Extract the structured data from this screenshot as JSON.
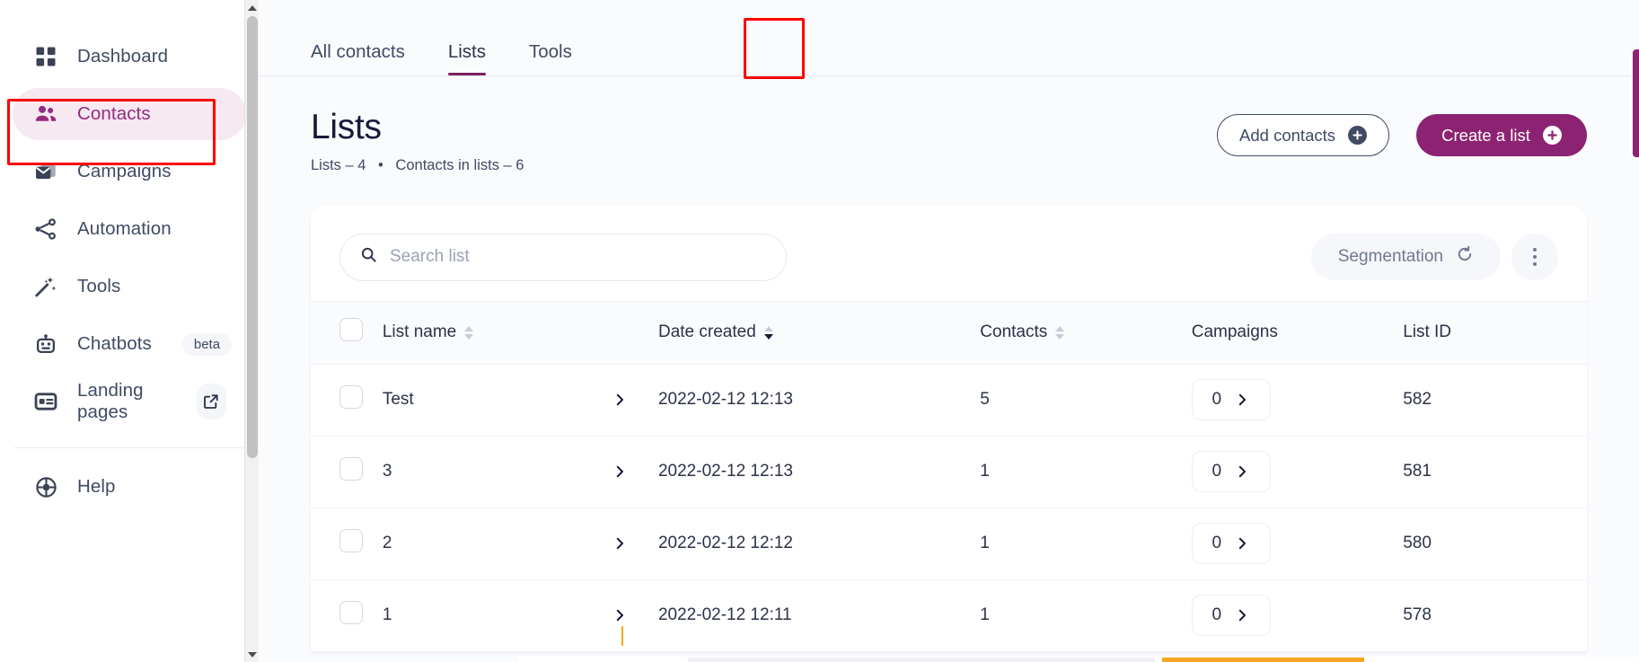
{
  "sidebar": {
    "items": [
      {
        "label": "Dashboard",
        "icon": "grid-icon",
        "active": false,
        "badge": null,
        "external": false
      },
      {
        "label": "Contacts",
        "icon": "contacts-icon",
        "active": true,
        "badge": null,
        "external": false
      },
      {
        "label": "Campaigns",
        "icon": "envelope-icon",
        "active": false,
        "badge": null,
        "external": false
      },
      {
        "label": "Automation",
        "icon": "automation-icon",
        "active": false,
        "badge": null,
        "external": false
      },
      {
        "label": "Tools",
        "icon": "magic-wand-icon",
        "active": false,
        "badge": null,
        "external": false
      },
      {
        "label": "Chatbots",
        "icon": "robot-icon",
        "active": false,
        "badge": "beta",
        "external": false
      },
      {
        "label": "Landing pages",
        "icon": "landing-page-icon",
        "active": false,
        "badge": null,
        "external": true
      }
    ],
    "help": {
      "label": "Help",
      "icon": "lifebuoy-icon"
    }
  },
  "tabs": [
    {
      "label": "All contacts",
      "active": false
    },
    {
      "label": "Lists",
      "active": true
    },
    {
      "label": "Tools",
      "active": false
    }
  ],
  "page": {
    "title": "Lists",
    "subtitle_lists": "Lists – 4",
    "subtitle_separator": "•",
    "subtitle_contacts": "Contacts in lists – 6"
  },
  "actions": {
    "add_contacts": "Add contacts",
    "create_list": "Create a list"
  },
  "toolbar": {
    "search_placeholder": "Search list",
    "search_value": "",
    "segmentation": "Segmentation",
    "more_menu": "more-options"
  },
  "table": {
    "columns": [
      {
        "key": "name",
        "label": "List name",
        "sortable": true,
        "sort": "none"
      },
      {
        "key": "date",
        "label": "Date created",
        "sortable": true,
        "sort": "desc"
      },
      {
        "key": "contacts",
        "label": "Contacts",
        "sortable": true,
        "sort": "none"
      },
      {
        "key": "campaigns",
        "label": "Campaigns",
        "sortable": false,
        "sort": "none"
      },
      {
        "key": "listid",
        "label": "List ID",
        "sortable": false,
        "sort": "none"
      }
    ],
    "rows": [
      {
        "name": "Test",
        "date": "2022-02-12 12:13",
        "contacts": "5",
        "campaigns": "0",
        "listid": "582"
      },
      {
        "name": "3",
        "date": "2022-02-12 12:13",
        "contacts": "1",
        "campaigns": "0",
        "listid": "581"
      },
      {
        "name": "2",
        "date": "2022-02-12 12:12",
        "contacts": "1",
        "campaigns": "0",
        "listid": "580"
      },
      {
        "name": "1",
        "date": "2022-02-12 12:11",
        "contacts": "1",
        "campaigns": "0",
        "listid": "578"
      }
    ]
  },
  "colors": {
    "accent": "#8c2372",
    "accent_soft": "#f6e9f2",
    "text": "#2b3247",
    "muted": "#6f7890",
    "annotation": "#ff0000",
    "page_bg": "#fafbfd"
  }
}
